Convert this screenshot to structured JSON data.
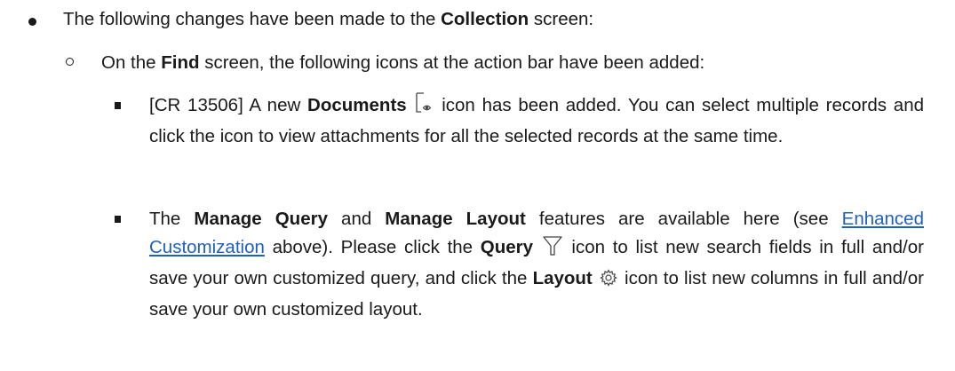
{
  "bullet1": {
    "pre": "The following changes have been made to the ",
    "bold": "Collection",
    "post": " screen:"
  },
  "bullet2": {
    "pre": "On the ",
    "bold": "Find",
    "post": " screen, the following icons at the action bar have been added:"
  },
  "item1": {
    "pre": "[CR 13506] A new ",
    "bold": "Documents",
    "icon": "document-view-icon",
    "post": " icon has been added. You can select multiple records and click the icon to view attachments for all the selected records at the same time."
  },
  "item2": {
    "pre": "The ",
    "bold1": "Manage Query",
    "mid1": " and ",
    "bold2": "Manage Layout",
    "mid2": " features are available here (see ",
    "link": "Enhanced Customization",
    "mid3": " above). Please click the ",
    "bold3": "Query",
    "icon1": "filter-icon",
    "mid4": " icon to list new search fields in full and/or save your own customized query, and click the ",
    "bold4": "Layout",
    "icon2": "gear-icon",
    "post": " icon to list new columns in full and/or save your own customized layout."
  },
  "colors": {
    "text": "#1a1a1a",
    "link": "#1f5fbf"
  }
}
